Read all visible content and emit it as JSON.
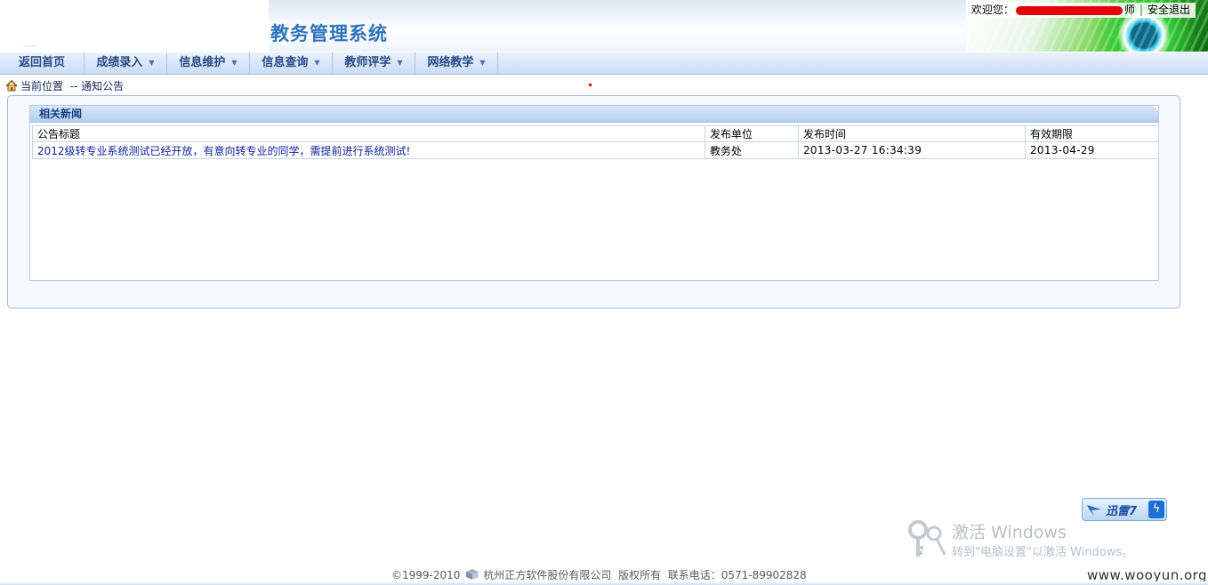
{
  "header": {
    "system_title": "教务管理系统",
    "welcome_prefix": "欢迎您：",
    "user_suffix": "师",
    "logout": "安全退出"
  },
  "nav": {
    "items": [
      {
        "label": "返回首页",
        "has_menu": false
      },
      {
        "label": "成绩录入",
        "has_menu": true
      },
      {
        "label": "信息维护",
        "has_menu": true
      },
      {
        "label": "信息查询",
        "has_menu": true
      },
      {
        "label": "教师评学",
        "has_menu": true
      },
      {
        "label": "网络教学",
        "has_menu": true
      }
    ]
  },
  "breadcrumb": {
    "current": "当前位置",
    "page": "-- 通知公告"
  },
  "panel": {
    "title": "相关新闻",
    "columns": [
      "公告标题",
      "发布单位",
      "发布时间",
      "有效期限"
    ],
    "rows": [
      {
        "title": "2012级转专业系统测试已经开放，有意向转专业的同学，需提前进行系统测试!",
        "unit": "教务处",
        "published": "2013-03-27 16:34:39",
        "expires": "2013-04-29"
      }
    ]
  },
  "overlays": {
    "xunlei": "迅雷7",
    "activate_title": "激活 Windows",
    "activate_sub": "转到\"电脑设置\"以激活 Windows。",
    "watermark": "www.wooyun.org"
  },
  "footer": {
    "copyright": "©1999-2010",
    "company": "杭州正方软件股份有限公司",
    "rights": "版权所有",
    "phone": "联系电话：0571-89902828"
  },
  "colors": {
    "title_blue": "#2f73bb",
    "nav_text": "#2a4a84",
    "link_blue": "#10209a",
    "redaction_red": "#e8000a"
  }
}
